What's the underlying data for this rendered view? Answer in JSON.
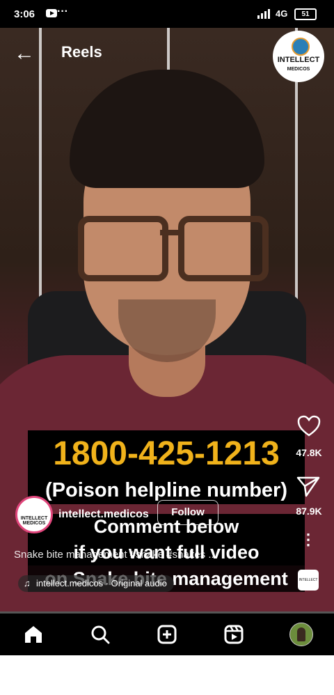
{
  "status_bar": {
    "time": "3:06",
    "dots": "···",
    "network": "4G",
    "battery": "51"
  },
  "header": {
    "back_icon": "←",
    "title": "Reels"
  },
  "brand": {
    "line1": "INTELLECT",
    "line2": "MEDICOS"
  },
  "overlay": {
    "phone_number": "1800-425-1213",
    "helpline": "(Poison helpline number)",
    "comment_line1": "Comment below",
    "comment_line2": "if you want full video",
    "comment_line3": "on Snake bite management"
  },
  "post": {
    "avatar_text": "INTELLECT MEDICOS",
    "username": "intellect.medicos",
    "follow_label": "Follow",
    "caption": "Snake bite management #snake #snakes ...",
    "audio": "intellect.medicos · Original audio",
    "thumb_text": "INTELLECT"
  },
  "actions": {
    "likes": "47.8K",
    "shares": "87.9K",
    "more": "⋮"
  },
  "progress": {
    "fraction": 0.0
  },
  "nav": {
    "items": [
      "home-icon",
      "search-icon",
      "create-icon",
      "reels-icon",
      "profile-avatar"
    ]
  },
  "colors": {
    "phone_text": "#f0b21b",
    "avatar_ring": "#e0457b",
    "shirt": "#6b2634"
  }
}
